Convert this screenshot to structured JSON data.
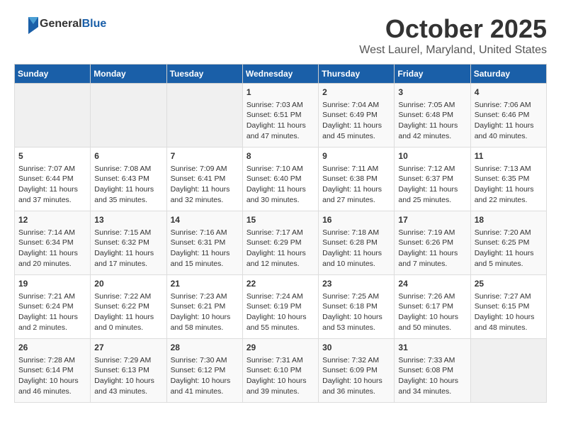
{
  "logo": {
    "general": "General",
    "blue": "Blue"
  },
  "title": "October 2025",
  "location": "West Laurel, Maryland, United States",
  "weekdays": [
    "Sunday",
    "Monday",
    "Tuesday",
    "Wednesday",
    "Thursday",
    "Friday",
    "Saturday"
  ],
  "weeks": [
    [
      {
        "day": "",
        "info": ""
      },
      {
        "day": "",
        "info": ""
      },
      {
        "day": "",
        "info": ""
      },
      {
        "day": "1",
        "info": "Sunrise: 7:03 AM\nSunset: 6:51 PM\nDaylight: 11 hours\nand 47 minutes."
      },
      {
        "day": "2",
        "info": "Sunrise: 7:04 AM\nSunset: 6:49 PM\nDaylight: 11 hours\nand 45 minutes."
      },
      {
        "day": "3",
        "info": "Sunrise: 7:05 AM\nSunset: 6:48 PM\nDaylight: 11 hours\nand 42 minutes."
      },
      {
        "day": "4",
        "info": "Sunrise: 7:06 AM\nSunset: 6:46 PM\nDaylight: 11 hours\nand 40 minutes."
      }
    ],
    [
      {
        "day": "5",
        "info": "Sunrise: 7:07 AM\nSunset: 6:44 PM\nDaylight: 11 hours\nand 37 minutes."
      },
      {
        "day": "6",
        "info": "Sunrise: 7:08 AM\nSunset: 6:43 PM\nDaylight: 11 hours\nand 35 minutes."
      },
      {
        "day": "7",
        "info": "Sunrise: 7:09 AM\nSunset: 6:41 PM\nDaylight: 11 hours\nand 32 minutes."
      },
      {
        "day": "8",
        "info": "Sunrise: 7:10 AM\nSunset: 6:40 PM\nDaylight: 11 hours\nand 30 minutes."
      },
      {
        "day": "9",
        "info": "Sunrise: 7:11 AM\nSunset: 6:38 PM\nDaylight: 11 hours\nand 27 minutes."
      },
      {
        "day": "10",
        "info": "Sunrise: 7:12 AM\nSunset: 6:37 PM\nDaylight: 11 hours\nand 25 minutes."
      },
      {
        "day": "11",
        "info": "Sunrise: 7:13 AM\nSunset: 6:35 PM\nDaylight: 11 hours\nand 22 minutes."
      }
    ],
    [
      {
        "day": "12",
        "info": "Sunrise: 7:14 AM\nSunset: 6:34 PM\nDaylight: 11 hours\nand 20 minutes."
      },
      {
        "day": "13",
        "info": "Sunrise: 7:15 AM\nSunset: 6:32 PM\nDaylight: 11 hours\nand 17 minutes."
      },
      {
        "day": "14",
        "info": "Sunrise: 7:16 AM\nSunset: 6:31 PM\nDaylight: 11 hours\nand 15 minutes."
      },
      {
        "day": "15",
        "info": "Sunrise: 7:17 AM\nSunset: 6:29 PM\nDaylight: 11 hours\nand 12 minutes."
      },
      {
        "day": "16",
        "info": "Sunrise: 7:18 AM\nSunset: 6:28 PM\nDaylight: 11 hours\nand 10 minutes."
      },
      {
        "day": "17",
        "info": "Sunrise: 7:19 AM\nSunset: 6:26 PM\nDaylight: 11 hours\nand 7 minutes."
      },
      {
        "day": "18",
        "info": "Sunrise: 7:20 AM\nSunset: 6:25 PM\nDaylight: 11 hours\nand 5 minutes."
      }
    ],
    [
      {
        "day": "19",
        "info": "Sunrise: 7:21 AM\nSunset: 6:24 PM\nDaylight: 11 hours\nand 2 minutes."
      },
      {
        "day": "20",
        "info": "Sunrise: 7:22 AM\nSunset: 6:22 PM\nDaylight: 11 hours\nand 0 minutes."
      },
      {
        "day": "21",
        "info": "Sunrise: 7:23 AM\nSunset: 6:21 PM\nDaylight: 10 hours\nand 58 minutes."
      },
      {
        "day": "22",
        "info": "Sunrise: 7:24 AM\nSunset: 6:19 PM\nDaylight: 10 hours\nand 55 minutes."
      },
      {
        "day": "23",
        "info": "Sunrise: 7:25 AM\nSunset: 6:18 PM\nDaylight: 10 hours\nand 53 minutes."
      },
      {
        "day": "24",
        "info": "Sunrise: 7:26 AM\nSunset: 6:17 PM\nDaylight: 10 hours\nand 50 minutes."
      },
      {
        "day": "25",
        "info": "Sunrise: 7:27 AM\nSunset: 6:15 PM\nDaylight: 10 hours\nand 48 minutes."
      }
    ],
    [
      {
        "day": "26",
        "info": "Sunrise: 7:28 AM\nSunset: 6:14 PM\nDaylight: 10 hours\nand 46 minutes."
      },
      {
        "day": "27",
        "info": "Sunrise: 7:29 AM\nSunset: 6:13 PM\nDaylight: 10 hours\nand 43 minutes."
      },
      {
        "day": "28",
        "info": "Sunrise: 7:30 AM\nSunset: 6:12 PM\nDaylight: 10 hours\nand 41 minutes."
      },
      {
        "day": "29",
        "info": "Sunrise: 7:31 AM\nSunset: 6:10 PM\nDaylight: 10 hours\nand 39 minutes."
      },
      {
        "day": "30",
        "info": "Sunrise: 7:32 AM\nSunset: 6:09 PM\nDaylight: 10 hours\nand 36 minutes."
      },
      {
        "day": "31",
        "info": "Sunrise: 7:33 AM\nSunset: 6:08 PM\nDaylight: 10 hours\nand 34 minutes."
      },
      {
        "day": "",
        "info": ""
      }
    ]
  ]
}
